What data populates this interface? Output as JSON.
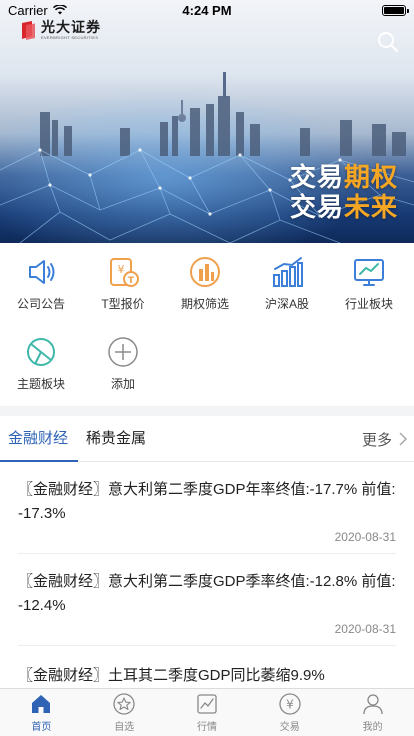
{
  "status_bar": {
    "carrier": "Carrier",
    "time": "4:24 PM"
  },
  "banner": {
    "logo_text": "光大证券",
    "logo_subtext": "EVERBRIGHT SECURITIES",
    "slogan_line1_a": "交易",
    "slogan_line1_b": "期权",
    "slogan_line2_a": "交易",
    "slogan_line2_b": "未来"
  },
  "grid": {
    "items": [
      {
        "label": "公司公告",
        "icon": "megaphone-icon"
      },
      {
        "label": "T型报价",
        "icon": "t-quote-icon"
      },
      {
        "label": "期权筛选",
        "icon": "options-filter-icon"
      },
      {
        "label": "沪深A股",
        "icon": "stock-bars-icon"
      },
      {
        "label": "行业板块",
        "icon": "industry-monitor-icon"
      },
      {
        "label": "主题板块",
        "icon": "pie-chart-icon"
      },
      {
        "label": "添加",
        "icon": "add-circle-icon"
      }
    ]
  },
  "tabs": {
    "items": [
      {
        "label": "金融财经",
        "active": true
      },
      {
        "label": "稀贵金属",
        "active": false
      }
    ],
    "more_label": "更多"
  },
  "news": [
    {
      "title": "〖金融财经〗意大利第二季度GDP年率终值:-17.7% 前值:-17.3%",
      "date": "2020-08-31"
    },
    {
      "title": "〖金融财经〗意大利第二季度GDP季率终值:-12.8% 前值:-12.4%",
      "date": "2020-08-31"
    },
    {
      "title": "〖金融财经〗土耳其二季度GDP同比萎缩9.9%",
      "date": ""
    }
  ],
  "bottom_nav": {
    "items": [
      {
        "label": "首页",
        "icon": "home-icon",
        "active": true
      },
      {
        "label": "自选",
        "icon": "star-icon",
        "active": false
      },
      {
        "label": "行情",
        "icon": "market-chart-icon",
        "active": false
      },
      {
        "label": "交易",
        "icon": "yen-coin-icon",
        "active": false
      },
      {
        "label": "我的",
        "icon": "user-icon",
        "active": false
      }
    ]
  },
  "colors": {
    "accent": "#2e63b5",
    "icon_blue": "#3b7fd9",
    "icon_orange": "#f0a04b",
    "icon_teal": "#3fb8a9",
    "slogan_accent": "#f5a623"
  }
}
